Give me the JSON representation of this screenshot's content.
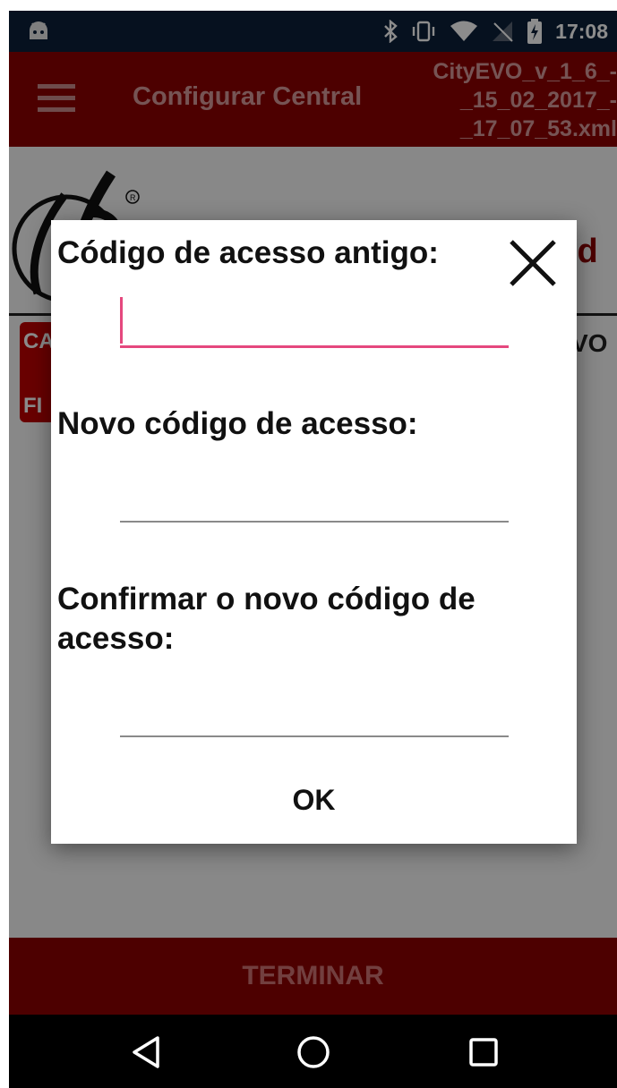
{
  "status_bar": {
    "time": "17:08",
    "icons": [
      "android-icon",
      "bluetooth-icon",
      "vibrate-icon",
      "wifi-icon",
      "no-sim-icon",
      "battery-charging-icon"
    ]
  },
  "app_bar": {
    "title": "Configurar Central",
    "file_name": "CityEVO_v_1_6_-\n_15_02_2017_-\n_17_07_53.xml",
    "menu_icon": "menu-icon"
  },
  "background": {
    "word_fragment": "ld",
    "tab_fragment_1": "CA",
    "tab_fragment_2": "FI",
    "right_fragment": "VO"
  },
  "dialog": {
    "old_code_label": "Código de acesso antigo:",
    "old_code_value": "",
    "new_code_label": "Novo código de acesso:",
    "new_code_value": "",
    "confirm_label": "Confirmar o novo código de acesso:",
    "confirm_value": "",
    "ok_label": "OK",
    "close_icon": "close-icon"
  },
  "footer": {
    "terminar_label": "TERMINAR"
  },
  "nav_bar": {
    "icons": [
      "back-icon",
      "home-icon",
      "recents-icon"
    ]
  }
}
